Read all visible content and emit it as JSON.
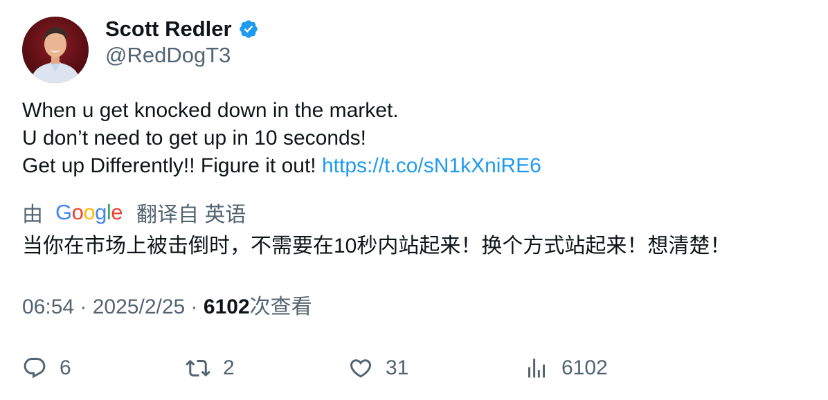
{
  "author": {
    "name": "Scott Redler",
    "handle": "@RedDogT3",
    "verified_icon": "verified-badge-icon",
    "avatar": "profile-photo"
  },
  "tweet": {
    "line1": "When u get knocked down in the market.",
    "line2": "U don’t need to get up in 10 seconds!",
    "line3_text": "Get up Differently!! Figure it out! ",
    "link": "https://t.co/sN1kXniRE6"
  },
  "translation": {
    "prefix": "由",
    "google": {
      "G": "G",
      "o1": "o",
      "o2": "o",
      "g": "g",
      "l": "l",
      "e": "e"
    },
    "suffix": "翻译自 英语",
    "text": "当你在市场上被击倒时，不需要在10秒内站起来！换个方式站起来！想清楚！"
  },
  "meta": {
    "time": "06:54",
    "sep1": " · ",
    "date": "2025/2/25",
    "sep2": " · ",
    "views": "6102",
    "views_label": "次查看"
  },
  "actions": {
    "replies": "6",
    "retweets": "2",
    "likes": "31",
    "views": "6102"
  },
  "colors": {
    "link": "#1d9bf0",
    "secondary": "#536471",
    "primary": "#0f1419",
    "verified": "#1d9bf0"
  }
}
